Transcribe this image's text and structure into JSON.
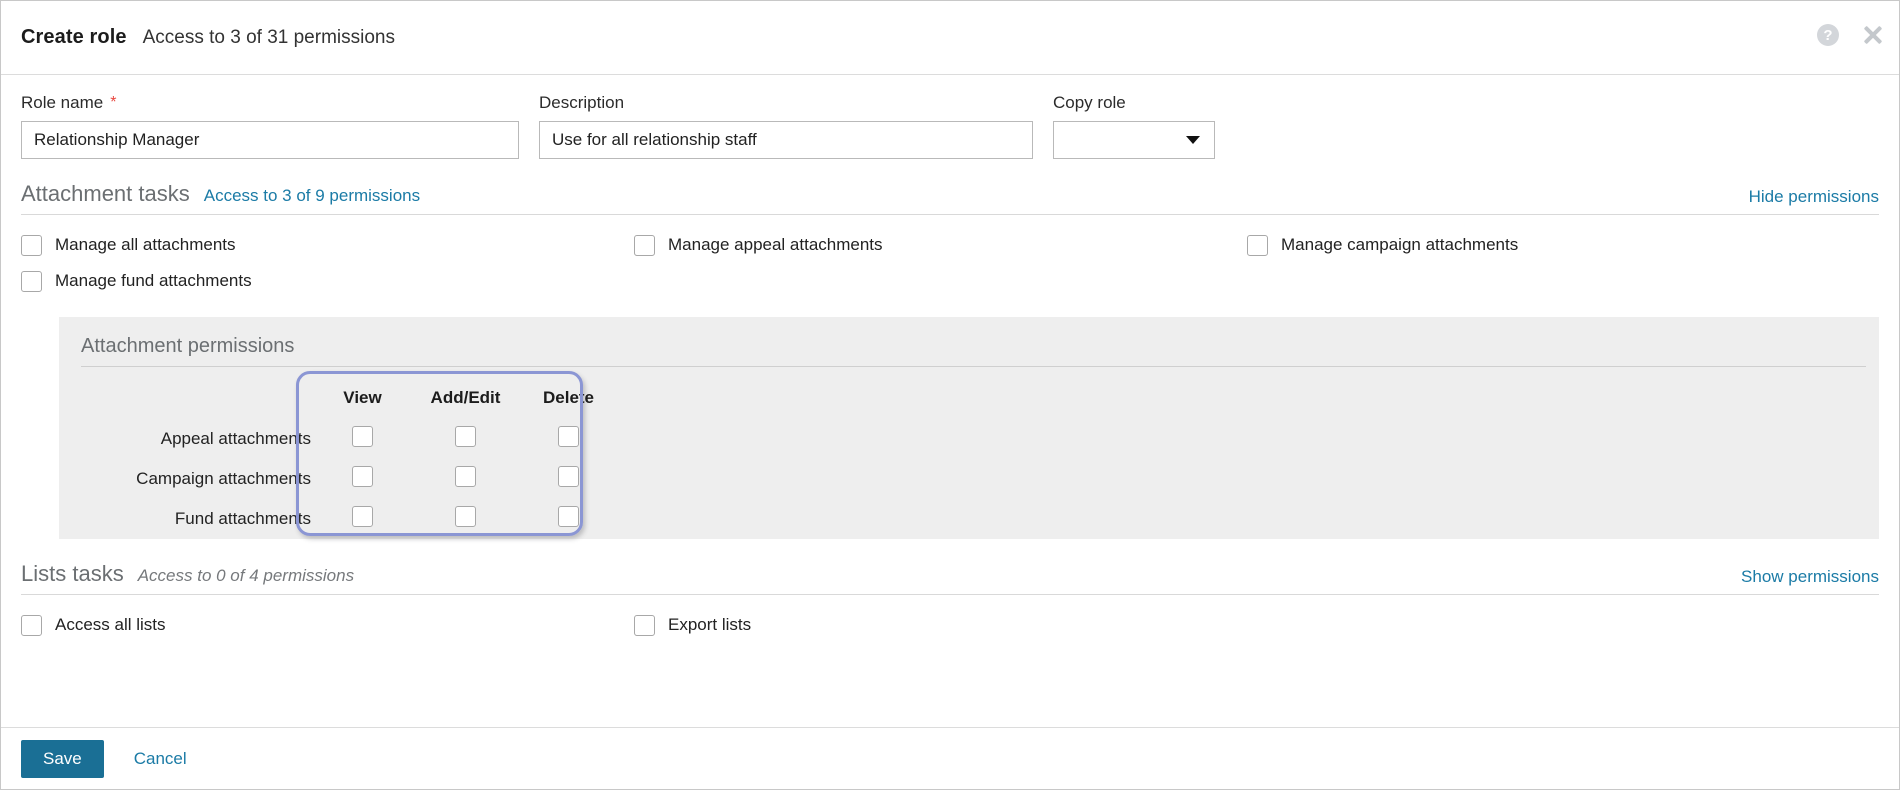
{
  "header": {
    "title": "Create role",
    "subtitle": "Access to 3 of 31 permissions",
    "help_icon": "help-circle-icon",
    "close_icon": "close-icon"
  },
  "form": {
    "role_name": {
      "label": "Role name",
      "required_marker": "*",
      "value": "Relationship Manager",
      "placeholder": ""
    },
    "description": {
      "label": "Description",
      "value": "Use for all relationship staff",
      "placeholder": ""
    },
    "copy_role": {
      "label": "Copy role",
      "value": "",
      "caret_icon": "chevron-down-icon"
    }
  },
  "sections": [
    {
      "title": "Attachment tasks",
      "access_text": "Access to 3 of 9 permissions",
      "access_is_link": true,
      "toggle_label": "Hide permissions",
      "checkboxes": [
        {
          "label": "Manage all attachments",
          "checked": false
        },
        {
          "label": "Manage appeal attachments",
          "checked": false
        },
        {
          "label": "Manage campaign attachments",
          "checked": false
        },
        {
          "label": "Manage fund attachments",
          "checked": false
        }
      ]
    },
    {
      "title": "Lists tasks",
      "access_text": "Access to 0 of 4 permissions",
      "access_is_link": false,
      "toggle_label": "Show permissions",
      "checkboxes": [
        {
          "label": "Access all lists",
          "checked": false
        },
        {
          "label": "Export lists",
          "checked": false
        }
      ]
    }
  ],
  "permissions_panel": {
    "title": "Attachment permissions",
    "columns": [
      "View",
      "Add/Edit",
      "Delete"
    ],
    "rows": [
      {
        "label": "Appeal attachments",
        "values": [
          false,
          false,
          false
        ]
      },
      {
        "label": "Campaign attachments",
        "values": [
          false,
          false,
          false
        ]
      },
      {
        "label": "Fund attachments",
        "values": [
          false,
          false,
          false
        ]
      }
    ],
    "highlight_color": "#8b96d4"
  },
  "footer": {
    "save_label": "Save",
    "cancel_label": "Cancel",
    "save_color": "#1a6f95",
    "link_color": "#1b7ba6"
  }
}
